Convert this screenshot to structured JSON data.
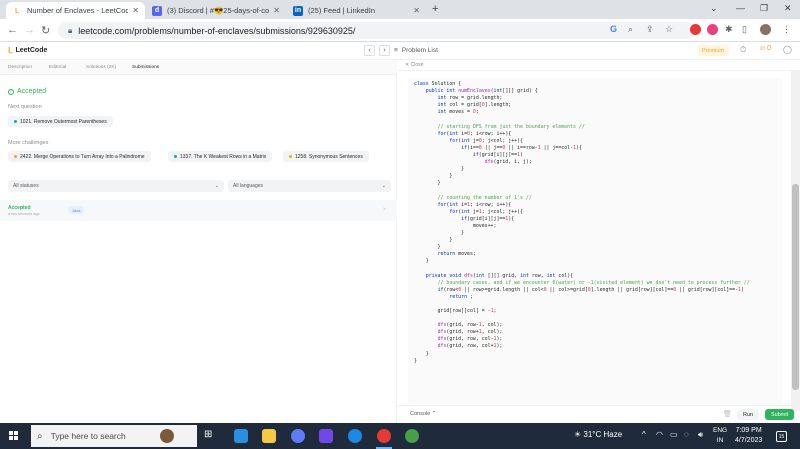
{
  "browser": {
    "tabs": [
      {
        "title": "Number of Enclaves - LeetCode",
        "favicon": "leetcode-icon",
        "color": "#ffa116",
        "active": true
      },
      {
        "title": "(3) Discord | #😎25-days-of-cod",
        "favicon": "discord-icon",
        "color": "#5865f2",
        "active": false
      },
      {
        "title": "(25) Feed | LinkedIn",
        "favicon": "linkedin-icon",
        "color": "#0a66c2",
        "active": false
      }
    ],
    "new_tab": "+",
    "url": "leetcode.com/problems/number-of-enclaves/submissions/929630925/"
  },
  "lc_header": {
    "logo": "LeetCode",
    "problem_list": "Problem List",
    "premium": "Premium",
    "streak": "0"
  },
  "left": {
    "tabs": [
      "Description",
      "Editorial",
      "Solutions (2K)",
      "Submissions"
    ],
    "status": "Accepted",
    "next_label": "Next question",
    "next_question": "1021. Remove Outermost Parentheses",
    "more_label": "More challenges",
    "challenges": [
      {
        "label": "2422. Merge Operations to Turn Array Into a Palindrome",
        "color": "#ffa116"
      },
      {
        "label": "1337. The K Weakest Rows in a Matrix",
        "color": "#00b8a3"
      },
      {
        "label": "1258. Synonymous Sentences",
        "color": "#ffa116"
      }
    ],
    "filter_status": "All statuses",
    "filter_lang": "All languages",
    "submission": {
      "status": "Accepted",
      "time": "a few seconds ago",
      "lang": "Java"
    }
  },
  "right": {
    "close": "Close",
    "console": "Console",
    "run": "Run",
    "submit": "Submit",
    "code_lines": [
      "class Solution {",
      "    public int numEnclaves(int[][] grid) {",
      "        int row = grid.length;",
      "        int col = grid[0].length;",
      "        int moves = 0;",
      "",
      "        // starting DFS from just the boundary elements //",
      "        for(int i=0; i<row; i++){",
      "            for(int j=0; j<col; j++){",
      "                if(i==0 || j==0 || i==row-1 || j==col-1){",
      "                    if(grid[i][j]==1)",
      "                        dfs(grid, i, j);",
      "                }",
      "            }",
      "        }",
      "",
      "        // counting the number of 1's //",
      "        for(int i=1; i<row; i++){",
      "            for(int j=1; j<col; j++){",
      "                if(grid[i][j]==1){",
      "                    moves++;",
      "                }",
      "            }",
      "        }",
      "        return moves;",
      "    }",
      "",
      "    private void dfs(int [][] grid, int row, int col){",
      "        // boundary cases, and if we encounter 0(water) or -1(visited element) we don't need to process further //",
      "        if(row<0 || row>=grid.length || col<0 || col>=grid[0].length || grid[row][col]==0 || grid[row][col]==-1)",
      "            return ;",
      "",
      "        grid[row][col] = -1;",
      "",
      "        dfs(grid, row-1, col);",
      "        dfs(grid, row+1, col);",
      "        dfs(grid, row, col-1);",
      "        dfs(grid, row, col+1);",
      "    }",
      "}"
    ]
  },
  "taskbar": {
    "search_placeholder": "Type here to search",
    "weather": "31°C  Haze",
    "lang": "ENG",
    "lang_sub": "IN",
    "time": "7:09 PM",
    "date": "4/7/2023",
    "notifications": "15"
  }
}
